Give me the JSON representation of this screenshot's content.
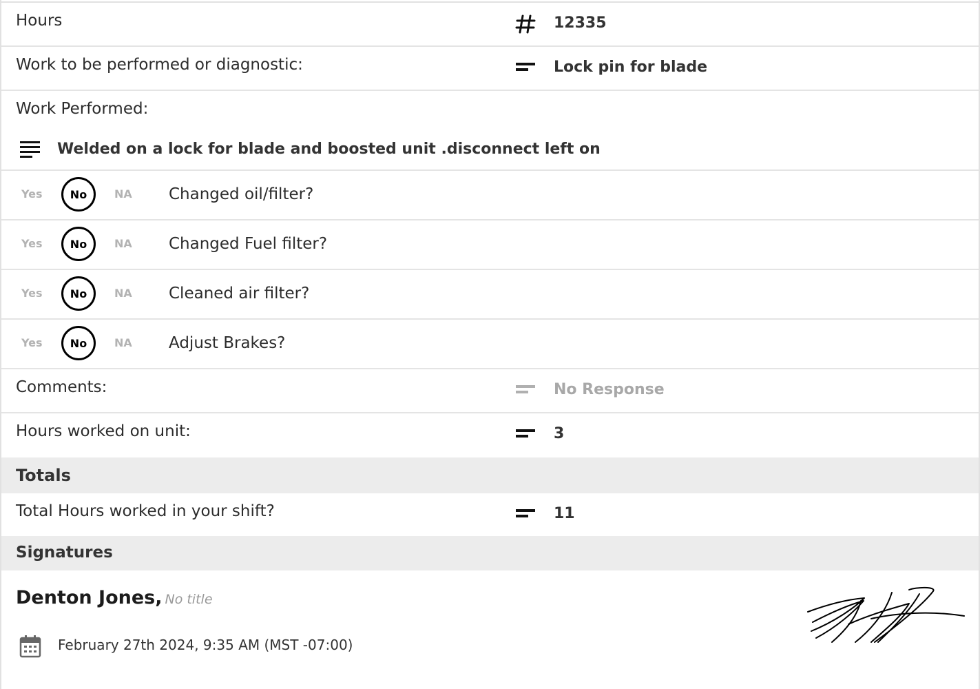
{
  "rows": {
    "hours": {
      "label": "Hours",
      "value": "12335",
      "icon": "hash-icon"
    },
    "work_to_perform": {
      "label": "Work to be performed or diagnostic:",
      "value": "Lock pin for blade",
      "icon": "short-text-icon"
    },
    "work_performed": {
      "label": "Work Performed:",
      "value": "Welded on a lock for blade and boosted unit .disconnect left on",
      "icon": "long-text-icon"
    }
  },
  "choices": {
    "yes": "Yes",
    "no": "No",
    "na": "NA"
  },
  "questions": [
    {
      "text": "Changed oil/filter?",
      "selected": "No"
    },
    {
      "text": "Changed Fuel filter?",
      "selected": "No"
    },
    {
      "text": "Cleaned air filter?",
      "selected": "No"
    },
    {
      "text": "Adjust Brakes?",
      "selected": "No"
    }
  ],
  "comments": {
    "label": "Comments:",
    "value": "No Response"
  },
  "hours_worked": {
    "label": "Hours worked on unit:",
    "value": "3"
  },
  "totals": {
    "heading": "Totals",
    "total_hours": {
      "label": "Total Hours worked in your shift?",
      "value": "11"
    }
  },
  "signatures": {
    "heading": "Signatures",
    "name": "Denton Jones,",
    "title": "No title",
    "date": "February 27th 2024, 9:35 AM (MST -07:00)"
  },
  "colors": {
    "border": "#e1e1e1",
    "section_bg": "#ececec",
    "muted": "#a8a8a8"
  }
}
